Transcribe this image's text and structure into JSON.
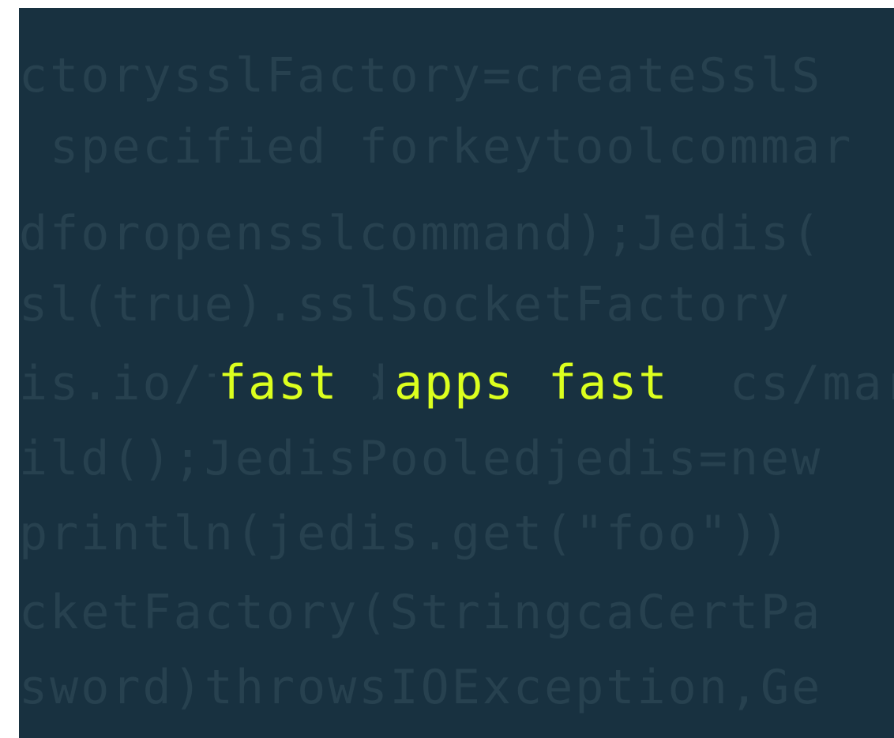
{
  "background_color": "#183140",
  "code_color": "#27414f",
  "accent_color": "#dcff1e",
  "code_lines": [
    "ctorysslFactory=createSslS",
    " specified forkeytoolcommar",
    "dforopensslcommand);Jedis(",
    "sl(true).sslSocketFactory",
    "is.io/fast dapps ofast cs/mar",
    "ild();JedisPooledjedis=new",
    "println(jedis.get(\"foo\"))",
    "cketFactory(StringcaCertPa",
    "sword)throwsIOException,Ge"
  ],
  "headline": {
    "word1": "fast",
    "word2": "apps",
    "word3": "fast"
  }
}
